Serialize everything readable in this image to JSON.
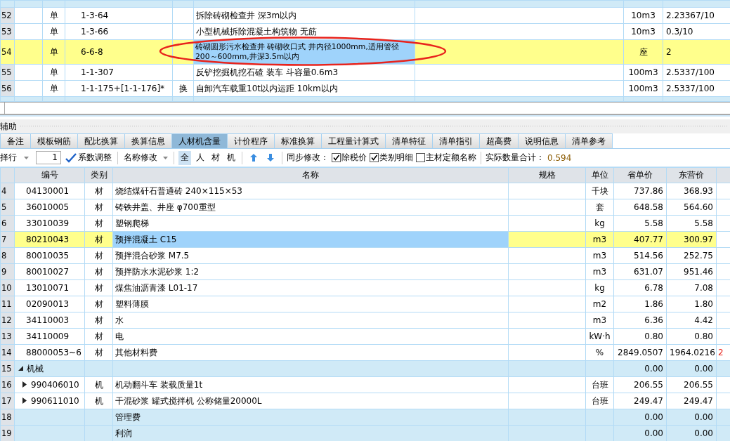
{
  "top_table": {
    "rows": [
      {
        "num": "52",
        "type": "单",
        "code": "1-3-64",
        "swap": "",
        "name": "拆除砖砌检查井 深3m以内",
        "unit": "10m3",
        "qty": "2.23367/10",
        "selected": false
      },
      {
        "num": "53",
        "type": "单",
        "code": "1-3-66",
        "swap": "",
        "name": "小型机械拆除混凝土构筑物 无筋",
        "unit": "10m3",
        "qty": "0.3/10",
        "selected": false
      },
      {
        "num": "54",
        "type": "单",
        "code": "6-6-8",
        "swap": "",
        "name": "砖砌圆形污水检查井 砖砌收口式 井内径1000mm,适用管径200～600mm,井深3.5m以内",
        "unit": "座",
        "qty": "2",
        "selected": true
      },
      {
        "num": "55",
        "type": "单",
        "code": "1-1-307",
        "swap": "",
        "name": "反铲挖掘机挖石碴 装车 斗容量0.6m3",
        "unit": "100m3",
        "qty": "2.5337/100",
        "selected": false
      },
      {
        "num": "56",
        "type": "单",
        "code": "1-1-175+[1-1-176]*",
        "swap": "换",
        "name": "自卸汽车载重10t以内运距 10km以内",
        "unit": "100m3",
        "qty": "2.5337/100",
        "selected": false
      }
    ]
  },
  "panel": {
    "title": "辅助"
  },
  "tabs": [
    {
      "label": "备注",
      "selected": false
    },
    {
      "label": "模板钢筋",
      "selected": false
    },
    {
      "label": "配比换算",
      "selected": false
    },
    {
      "label": "换算信息",
      "selected": false
    },
    {
      "label": "人材机含量",
      "selected": true
    },
    {
      "label": "计价程序",
      "selected": false
    },
    {
      "label": "标准换算",
      "selected": false
    },
    {
      "label": "工程量计算式",
      "selected": false
    },
    {
      "label": "清单特征",
      "selected": false
    },
    {
      "label": "清单指引",
      "selected": false
    },
    {
      "label": "超高费",
      "selected": false
    },
    {
      "label": "说明信息",
      "selected": false
    },
    {
      "label": "清单参考",
      "selected": false
    }
  ],
  "toolbar": {
    "select_row": "择行",
    "row_input": "1",
    "coef_button": "系数调整",
    "rename_button": "名称修改",
    "filters": [
      {
        "label": "全",
        "selected": true
      },
      {
        "label": "人",
        "selected": false
      },
      {
        "label": "材",
        "selected": false
      },
      {
        "label": "机",
        "selected": false
      }
    ],
    "sync_label": "同步修改：",
    "checks": [
      {
        "label": "除税价",
        "checked": true
      },
      {
        "label": "类别明细",
        "checked": true
      },
      {
        "label": "主材定额名称",
        "checked": false
      }
    ],
    "total_label": "实际数量合计：",
    "total_value": "0.594"
  },
  "grid": {
    "columns": [
      "编号",
      "类别",
      "名称",
      "规格",
      "单位",
      "省单价",
      "东营价"
    ],
    "rows": [
      {
        "num": "4",
        "kind": "item",
        "code": "04130001",
        "type": "材",
        "name": "烧结煤矸石普通砖 240×115×53",
        "unit": "千块",
        "price": "737.86",
        "local": "368.93",
        "selected": false
      },
      {
        "num": "5",
        "kind": "item",
        "code": "36010005",
        "type": "材",
        "name": "铸铁井盖、井座 φ700重型",
        "unit": "套",
        "price": "648.58",
        "local": "564.60",
        "selected": false
      },
      {
        "num": "6",
        "kind": "item",
        "code": "33010039",
        "type": "材",
        "name": "塑钢爬梯",
        "unit": "kg",
        "price": "5.58",
        "local": "5.58",
        "selected": false
      },
      {
        "num": "7",
        "kind": "item",
        "code": "80210043",
        "type": "材",
        "name": "预拌混凝土 C15",
        "unit": "m3",
        "price": "407.77",
        "local": "300.97",
        "selected": true
      },
      {
        "num": "8",
        "kind": "item",
        "code": "80010035",
        "type": "材",
        "name": "预拌混合砂浆 M7.5",
        "unit": "m3",
        "price": "514.56",
        "local": "252.75",
        "selected": false
      },
      {
        "num": "9",
        "kind": "item",
        "code": "80010027",
        "type": "材",
        "name": "预拌防水水泥砂浆 1:2",
        "unit": "m3",
        "price": "631.07",
        "local": "951.46",
        "selected": false
      },
      {
        "num": "10",
        "kind": "item",
        "code": "13010071",
        "type": "材",
        "name": "煤焦油沥青漆 L01-17",
        "unit": "kg",
        "price": "6.78",
        "local": "7.08",
        "selected": false
      },
      {
        "num": "11",
        "kind": "item",
        "code": "02090013",
        "type": "材",
        "name": "塑料薄膜",
        "unit": "m2",
        "price": "1.86",
        "local": "1.80",
        "selected": false
      },
      {
        "num": "12",
        "kind": "item",
        "code": "34110003",
        "type": "材",
        "name": "水",
        "unit": "m3",
        "price": "6.36",
        "local": "4.42",
        "selected": false
      },
      {
        "num": "13",
        "kind": "item",
        "code": "34110009",
        "type": "材",
        "name": "电",
        "unit": "kW·h",
        "price": "0.80",
        "local": "0.80",
        "selected": false
      },
      {
        "num": "14",
        "kind": "item",
        "code": "88000053~6",
        "type": "材",
        "name": "其他材料费",
        "unit": "%",
        "price": "2849.0507",
        "local": "1964.0216",
        "extra": "2",
        "selected": false
      },
      {
        "num": "15",
        "kind": "group",
        "code": "机械",
        "expanded": true,
        "price": "0.00",
        "local": "0.00",
        "selected": false
      },
      {
        "num": "16",
        "kind": "item",
        "code": "990406010",
        "expanded": false,
        "type": "机",
        "name": "机动翻斗车 装载质量1t",
        "unit": "台班",
        "price": "206.55",
        "local": "206.55",
        "selected": false
      },
      {
        "num": "17",
        "kind": "item",
        "code": "990611010",
        "expanded": false,
        "type": "机",
        "name": "干混砂浆 罐式搅拌机 公称储量20000L",
        "unit": "台班",
        "price": "249.47",
        "local": "249.47",
        "selected": false
      },
      {
        "num": "18",
        "kind": "group",
        "name": "管理费",
        "price": "0.00",
        "local": "0.00",
        "selected": false
      },
      {
        "num": "19",
        "kind": "group",
        "name": "利润",
        "price": "0.00",
        "local": "0.00",
        "selected": false
      }
    ]
  }
}
